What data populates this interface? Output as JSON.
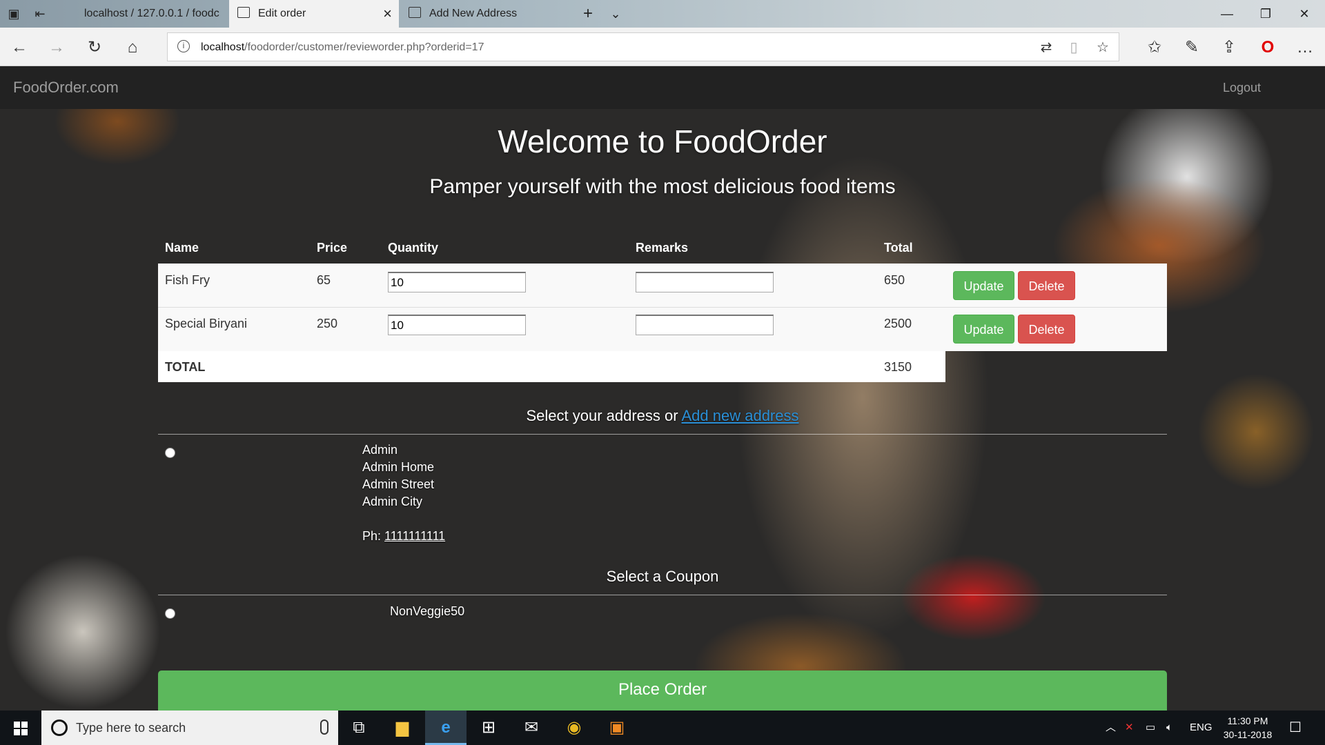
{
  "browser": {
    "tabs": [
      {
        "label": "localhost / 127.0.0.1 / foodc"
      },
      {
        "label": "Edit order"
      },
      {
        "label": "Add New Address"
      }
    ],
    "url_host": "localhost",
    "url_path": "/foodorder/customer/revieworder.php?orderid=17"
  },
  "navbar": {
    "brand": "FoodOrder.com",
    "logout": "Logout"
  },
  "hero": {
    "title": "Welcome to FoodOrder",
    "subtitle": "Pamper yourself with the most delicious food items"
  },
  "table": {
    "headers": [
      "Name",
      "Price",
      "Quantity",
      "Remarks",
      "Total"
    ],
    "rows": [
      {
        "name": "Fish Fry",
        "price": "65",
        "quantity": "10",
        "remarks": "",
        "total": "650",
        "update": "Update",
        "delete": "Delete"
      },
      {
        "name": "Special Biryani",
        "price": "250",
        "quantity": "10",
        "remarks": "",
        "total": "2500",
        "update": "Update",
        "delete": "Delete"
      }
    ],
    "total_label": "TOTAL",
    "total_value": "3150"
  },
  "address": {
    "heading": "Select your address or",
    "add_link": "Add new address",
    "lines": [
      "Admin",
      "Admin Home",
      "Admin Street",
      "Admin City"
    ],
    "phone_label": "Ph:",
    "phone": "1111111111"
  },
  "coupon": {
    "heading": "Select a Coupon",
    "name": "NonVeggie50"
  },
  "place_order": "Place Order",
  "taskbar": {
    "search_placeholder": "Type here to search",
    "lang": "ENG",
    "time": "11:30 PM",
    "date": "30-11-2018"
  }
}
